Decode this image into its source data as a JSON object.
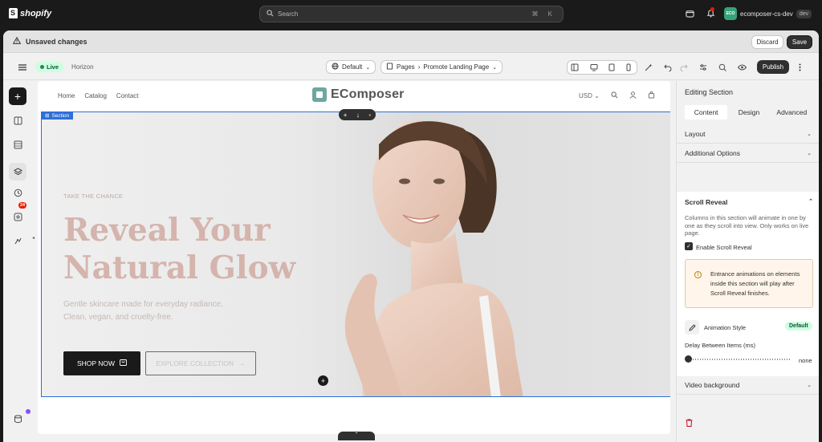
{
  "shopify": {
    "logo_text": "shopify",
    "search_placeholder": "Search",
    "search_shortcut": "⌘ K",
    "store_initials": "ECO",
    "store_name": "ecomposer-cs-dev",
    "store_tag": "dev"
  },
  "savebar": {
    "message": "Unsaved changes",
    "discard": "Discard",
    "save": "Save"
  },
  "toolbar": {
    "status": "Live",
    "theme": "Horizon",
    "locale": "Default",
    "pages_label": "Pages",
    "page_name": "Promote Landing Page",
    "publish": "Publish"
  },
  "rail": {
    "badge_count": "24"
  },
  "canvas": {
    "nav": [
      "Home",
      "Catalog",
      "Contact"
    ],
    "brand": "EComposer",
    "currency": "USD",
    "section_tag": "Section",
    "hero": {
      "kicker": "TAKE THE CHANCE",
      "headline_1": "Reveal Your",
      "headline_2": "Natural Glow",
      "sub_1": "Gentle skincare made for everyday radiance.",
      "sub_2": "Clean, vegan, and cruelty-free.",
      "primary_cta": "SHOP NOW",
      "secondary_cta": "EXPLORE COLLECTION"
    }
  },
  "panel": {
    "title": "Editing Section",
    "tabs": [
      "Content",
      "Design",
      "Advanced"
    ],
    "active_tab": "Content",
    "sections": {
      "layout": "Layout",
      "additional": "Additional Options",
      "scroll_reveal": "Scroll Reveal",
      "video": "Video background"
    },
    "scroll_reveal": {
      "description": "Columns in this section will animate in one by one as they scroll into view. Only works on live page.",
      "enable_label": "Enable Scroll Reveal",
      "enabled": true,
      "warning": "Entrance animations on elements inside this section will play after Scroll Reveal finishes.",
      "animation_style_label": "Animation Style",
      "animation_style_value": "Default",
      "delay_label": "Delay Between Items (ms)",
      "delay_value": "none"
    }
  },
  "colors": {
    "accent_blue": "#2e6fd9",
    "live_green": "#29845a",
    "headline": "#d4b4ac"
  }
}
